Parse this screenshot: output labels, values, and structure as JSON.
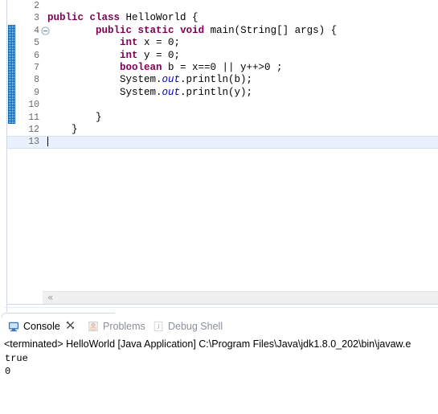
{
  "editor": {
    "first_visible_line": 2,
    "current_line": 13,
    "fold_marker_line": 4,
    "change_bar": {
      "from_line": 4,
      "to_line": 11,
      "color": "#1f7ec4"
    },
    "scrollbar": {
      "left_arrow_glyph": "«"
    },
    "lines": [
      {
        "n": "2",
        "tokens": []
      },
      {
        "n": "3",
        "tokens": [
          {
            "t": "public",
            "c": "kw"
          },
          {
            "t": " ",
            "c": ""
          },
          {
            "t": "class",
            "c": "kw"
          },
          {
            "t": " HelloWorld {",
            "c": ""
          }
        ]
      },
      {
        "n": "4",
        "fold": true,
        "tokens": [
          {
            "t": "        ",
            "c": ""
          },
          {
            "t": "public",
            "c": "kw"
          },
          {
            "t": " ",
            "c": ""
          },
          {
            "t": "static",
            "c": "kw"
          },
          {
            "t": " ",
            "c": ""
          },
          {
            "t": "void",
            "c": "kw"
          },
          {
            "t": " main(String[] args) {",
            "c": ""
          }
        ]
      },
      {
        "n": "5",
        "tokens": [
          {
            "t": "            ",
            "c": ""
          },
          {
            "t": "int",
            "c": "kw"
          },
          {
            "t": " x = 0;",
            "c": ""
          }
        ]
      },
      {
        "n": "6",
        "tokens": [
          {
            "t": "            ",
            "c": ""
          },
          {
            "t": "int",
            "c": "kw"
          },
          {
            "t": " y = 0;",
            "c": ""
          }
        ]
      },
      {
        "n": "7",
        "tokens": [
          {
            "t": "            ",
            "c": ""
          },
          {
            "t": "boolean",
            "c": "kw"
          },
          {
            "t": " b = x==0 || y++>0 ;",
            "c": ""
          }
        ]
      },
      {
        "n": "8",
        "tokens": [
          {
            "t": "            System.",
            "c": ""
          },
          {
            "t": "out",
            "c": "fld"
          },
          {
            "t": ".println(b);",
            "c": ""
          }
        ]
      },
      {
        "n": "9",
        "tokens": [
          {
            "t": "            System.",
            "c": ""
          },
          {
            "t": "out",
            "c": "fld"
          },
          {
            "t": ".println(y);",
            "c": ""
          }
        ]
      },
      {
        "n": "10",
        "tokens": []
      },
      {
        "n": "11",
        "tokens": [
          {
            "t": "        }",
            "c": ""
          }
        ]
      },
      {
        "n": "12",
        "tokens": [
          {
            "t": "    }",
            "c": ""
          }
        ]
      },
      {
        "n": "13",
        "current": true,
        "tokens": []
      }
    ]
  },
  "console_view": {
    "tabs": [
      {
        "label": "Console",
        "icon": "console-icon",
        "active": true,
        "closable": true,
        "close_glyph": "✖"
      },
      {
        "label": "Problems",
        "icon": "problems-icon",
        "active": false,
        "closable": false
      },
      {
        "label": "Debug Shell",
        "icon": "debug-shell-icon",
        "active": false,
        "closable": false
      }
    ],
    "header": "<terminated> HelloWorld [Java Application] C:\\Program Files\\Java\\jdk1.8.0_202\\bin\\javaw.e",
    "output_lines": [
      "true",
      "0"
    ],
    "output_text": "true\n0"
  },
  "colors": {
    "keyword": "#7f0055",
    "field": "#0000c0",
    "line_number": "#6a6a6a",
    "current_line_bg": "#e8f1fc",
    "change_bar": "#1f7ec4",
    "tab_active_text": "#000000",
    "tab_inactive_text": "#8a8f99"
  }
}
